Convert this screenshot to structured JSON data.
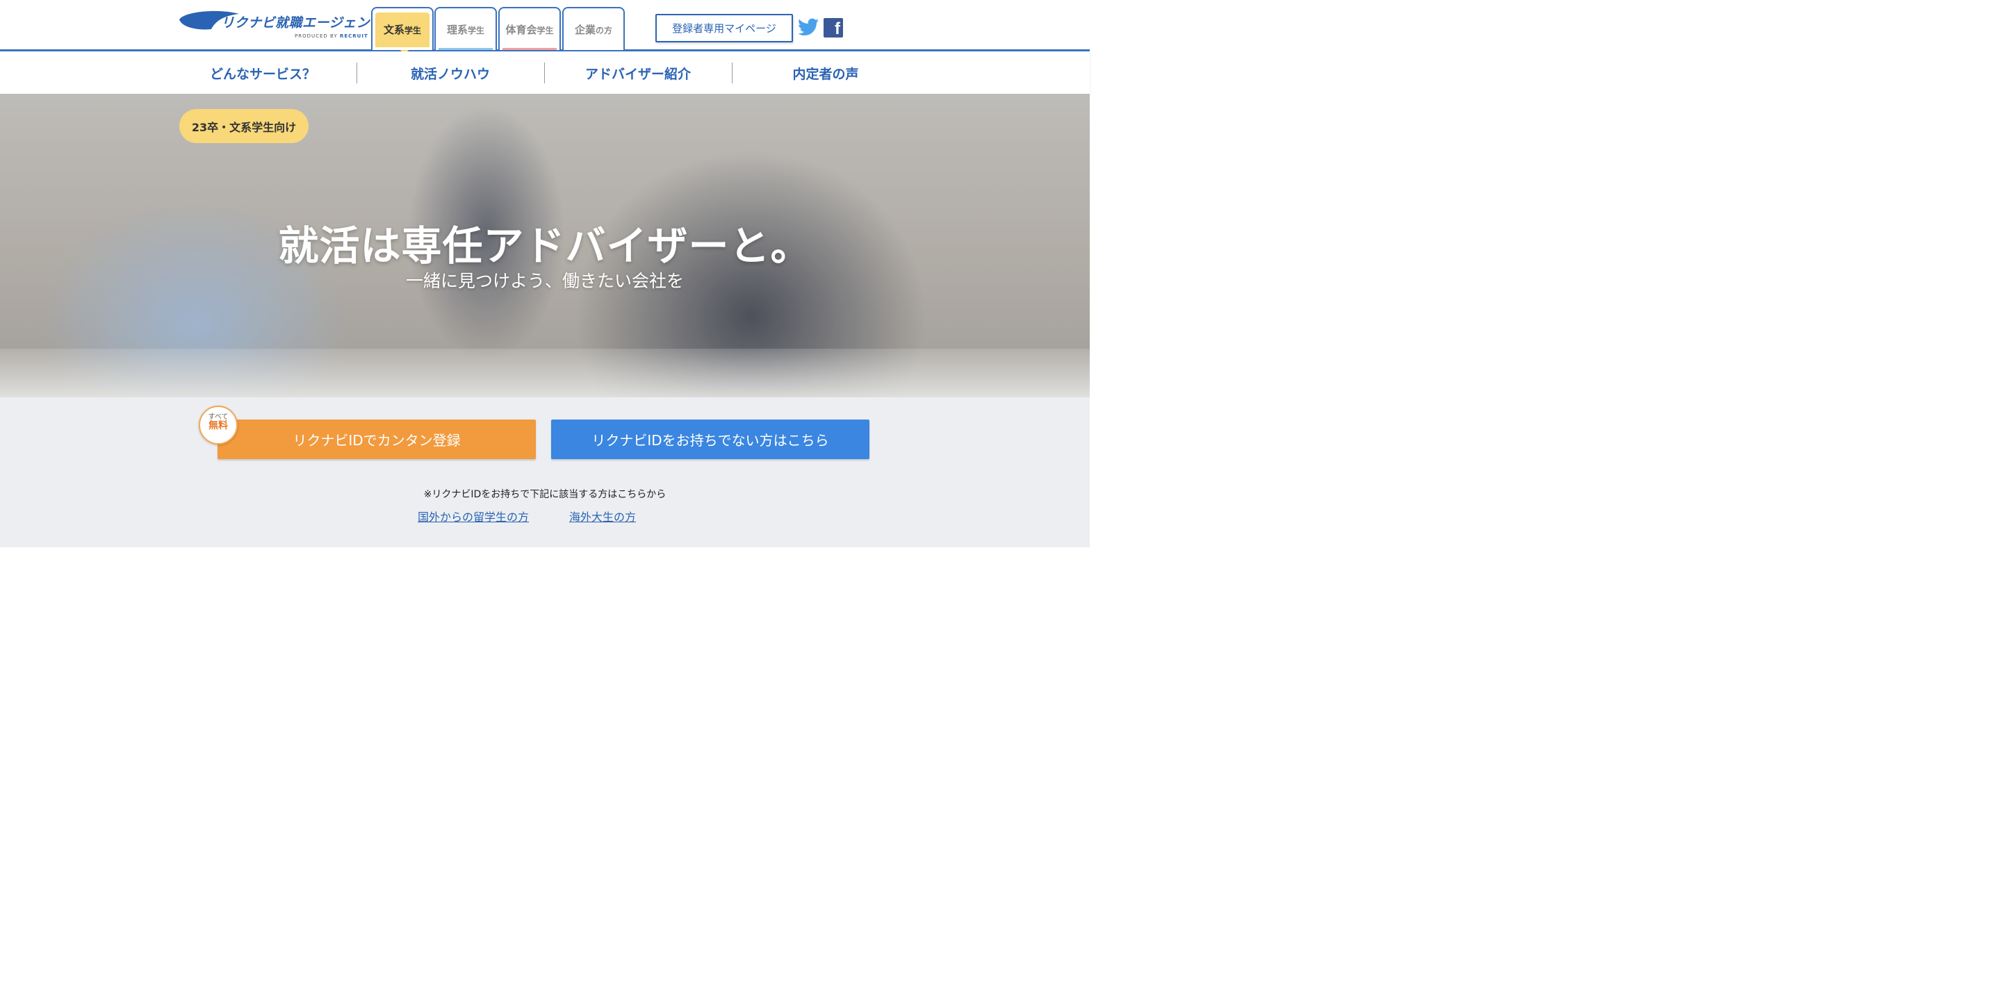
{
  "header": {
    "logo_text": "リクナビ就職エージェント",
    "logo_sub_prefix": "PRODUCED BY ",
    "logo_sub_brand": "RECRUIT",
    "tabs": [
      {
        "main": "文系",
        "suffix": "学生",
        "active": true,
        "accent": "#f8d878"
      },
      {
        "main": "理系",
        "suffix": "学生",
        "active": false,
        "accent": "#8fc6ef"
      },
      {
        "main": "体育会",
        "suffix": "学生",
        "active": false,
        "accent": "#f2a0a0"
      },
      {
        "main": "企業",
        "suffix": "の方",
        "active": false,
        "accent": "#ffffff"
      }
    ],
    "mypage_label": "登録者専用マイページ",
    "social": {
      "twitter_icon": "twitter-icon",
      "facebook_icon": "facebook-icon",
      "facebook_glyph": "f"
    }
  },
  "subnav": {
    "items": [
      "どんなサービス？",
      "就活ノウハウ",
      "アドバイザー紹介",
      "内定者の声"
    ]
  },
  "hero": {
    "badge": "23卒・文系学生向け",
    "title": "就活は専任アドバイザーと。",
    "subtitle": "一緒に見つけよう、働きたい会社を"
  },
  "cta": {
    "free_badge_small": "すべて",
    "free_badge_big": "無料",
    "register_label": "リクナビIDでカンタン登録",
    "no_id_label": "リクナビIDをお持ちでない方はこちら",
    "note": "※リクナビIDをお持ちで下記に該当する方はこちらから",
    "links": [
      "国外からの留学生の方",
      "海外大生の方"
    ]
  },
  "colors": {
    "brand_blue": "#2a63b3",
    "yellow": "#f8d878",
    "orange": "#f29a3e",
    "button_blue": "#3a86e0"
  }
}
